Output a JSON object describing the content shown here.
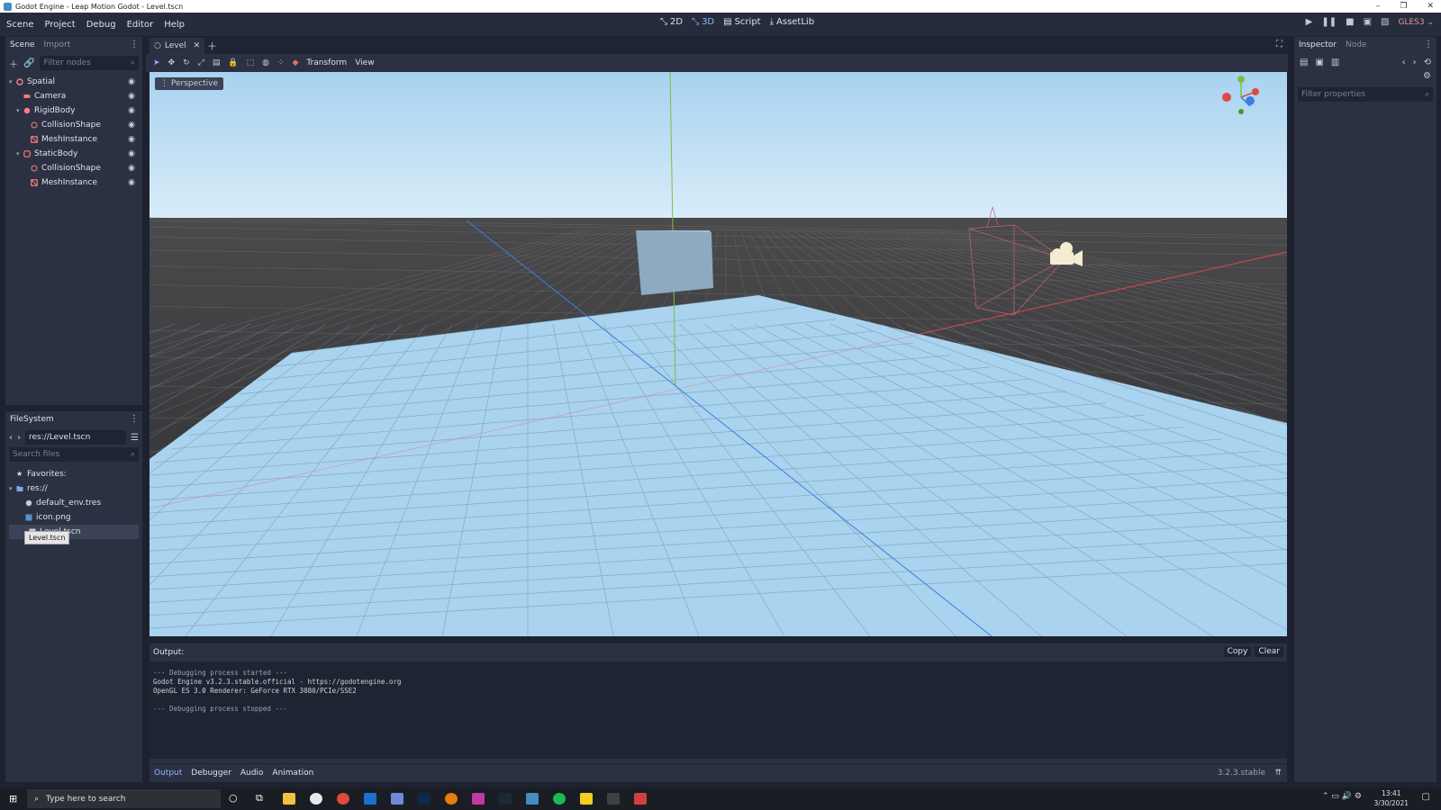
{
  "window": {
    "title": "Godot Engine - Leap Motion Godot - Level.tscn",
    "controls": [
      "–",
      "❐",
      "✕"
    ]
  },
  "menu": [
    "Scene",
    "Project",
    "Debug",
    "Editor",
    "Help"
  ],
  "workspaces": [
    {
      "label": "2D",
      "icon": "2d-icon"
    },
    {
      "label": "3D",
      "icon": "3d-icon",
      "active": true
    },
    {
      "label": "Script",
      "icon": "script-icon"
    },
    {
      "label": "AssetLib",
      "icon": "assetlib-icon"
    }
  ],
  "renderer": "GLES3",
  "scene_dock": {
    "tabs": [
      "Scene",
      "Import"
    ],
    "filter_placeholder": "Filter nodes",
    "nodes": [
      {
        "label": "Spatial",
        "depth": 0,
        "icon": "spatial-icon",
        "color": "#fc7f7f",
        "expanded": true
      },
      {
        "label": "Camera",
        "depth": 1,
        "icon": "camera-icon",
        "color": "#fc7f7f"
      },
      {
        "label": "RigidBody",
        "depth": 1,
        "icon": "rigidbody-icon",
        "color": "#fc7f7f",
        "expanded": true
      },
      {
        "label": "CollisionShape",
        "depth": 2,
        "icon": "collisionshape-icon",
        "color": "#fc7f7f"
      },
      {
        "label": "MeshInstance",
        "depth": 2,
        "icon": "meshinstance-icon",
        "color": "#fc7f7f"
      },
      {
        "label": "StaticBody",
        "depth": 1,
        "icon": "staticbody-icon",
        "color": "#fc7f7f",
        "expanded": true
      },
      {
        "label": "CollisionShape",
        "depth": 2,
        "icon": "collisionshape-icon",
        "color": "#fc7f7f"
      },
      {
        "label": "MeshInstance",
        "depth": 2,
        "icon": "meshinstance-icon",
        "color": "#fc7f7f"
      }
    ]
  },
  "filesystem": {
    "title": "FileSystem",
    "path": "res://Level.tscn",
    "search_placeholder": "Search files",
    "items": [
      {
        "label": "Favorites:",
        "depth": 0,
        "icon": "star-icon"
      },
      {
        "label": "res://",
        "depth": 0,
        "icon": "folder-icon",
        "expanded": true
      },
      {
        "label": "default_env.tres",
        "depth": 1,
        "icon": "environment-icon"
      },
      {
        "label": "icon.png",
        "depth": 1,
        "icon": "image-icon"
      },
      {
        "label": "Level.tscn",
        "depth": 1,
        "icon": "scene-icon",
        "selected": true
      }
    ],
    "tooltip": "Level.tscn"
  },
  "editor_tabs": [
    {
      "label": "Level",
      "closable": true
    }
  ],
  "viewport_toolbar": {
    "transform": "Transform",
    "view": "View"
  },
  "viewport": {
    "label": "Perspective"
  },
  "inspector": {
    "tabs": [
      "Inspector",
      "Node"
    ],
    "filter_placeholder": "Filter properties"
  },
  "output": {
    "title": "Output:",
    "copy": "Copy",
    "clear": "Clear",
    "lines": [
      "--- Debugging process started ---",
      "Godot Engine v3.2.3.stable.official - https://godotengine.org",
      "OpenGL ES 3.0 Renderer: GeForce RTX 3080/PCIe/SSE2",
      "",
      "--- Debugging process stopped ---"
    ]
  },
  "bottom_tabs": [
    "Output",
    "Debugger",
    "Audio",
    "Animation"
  ],
  "version": "3.2.3.stable",
  "taskbar": {
    "search_placeholder": "Type here to search",
    "time": "13:41",
    "date": "3/30/2021"
  },
  "colors": {
    "accent": "#8eb4ff",
    "panel": "#2b3142",
    "dark": "#1f2433"
  }
}
